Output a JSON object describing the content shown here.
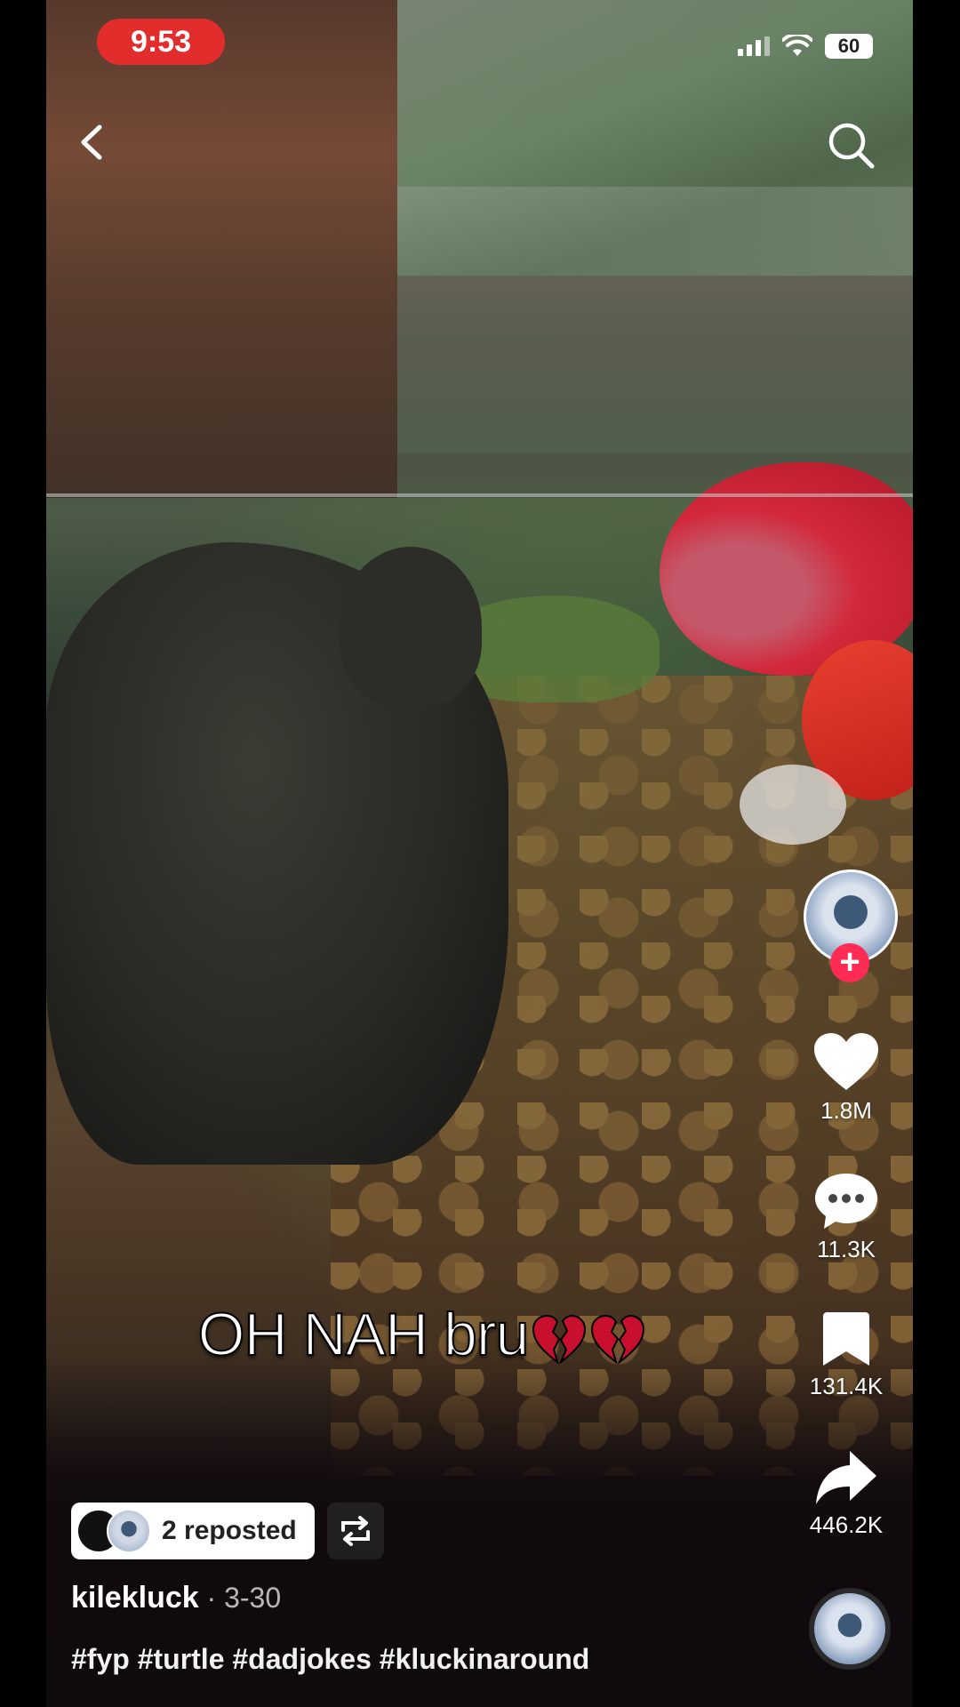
{
  "status_bar": {
    "time": "9:53",
    "battery": "60",
    "time_badge_color": "#e32d2d"
  },
  "nav": {
    "back_icon": "chevron-left-icon",
    "search_icon": "search-icon"
  },
  "video": {
    "overlay_text": "OH NAH bru",
    "overlay_emoji": "broken-heart-icon"
  },
  "actions": {
    "follow_label": "+",
    "likes": "1.8M",
    "comments": "11.3K",
    "saves": "131.4K",
    "shares": "446.2K",
    "accent_color": "#fe2c55"
  },
  "repost": {
    "label": "2 reposted"
  },
  "post": {
    "author": "kilekluck",
    "separator": " · ",
    "date": "3-30",
    "hashtags": "#fyp #turtle #dadjokes #kluckinaround"
  }
}
